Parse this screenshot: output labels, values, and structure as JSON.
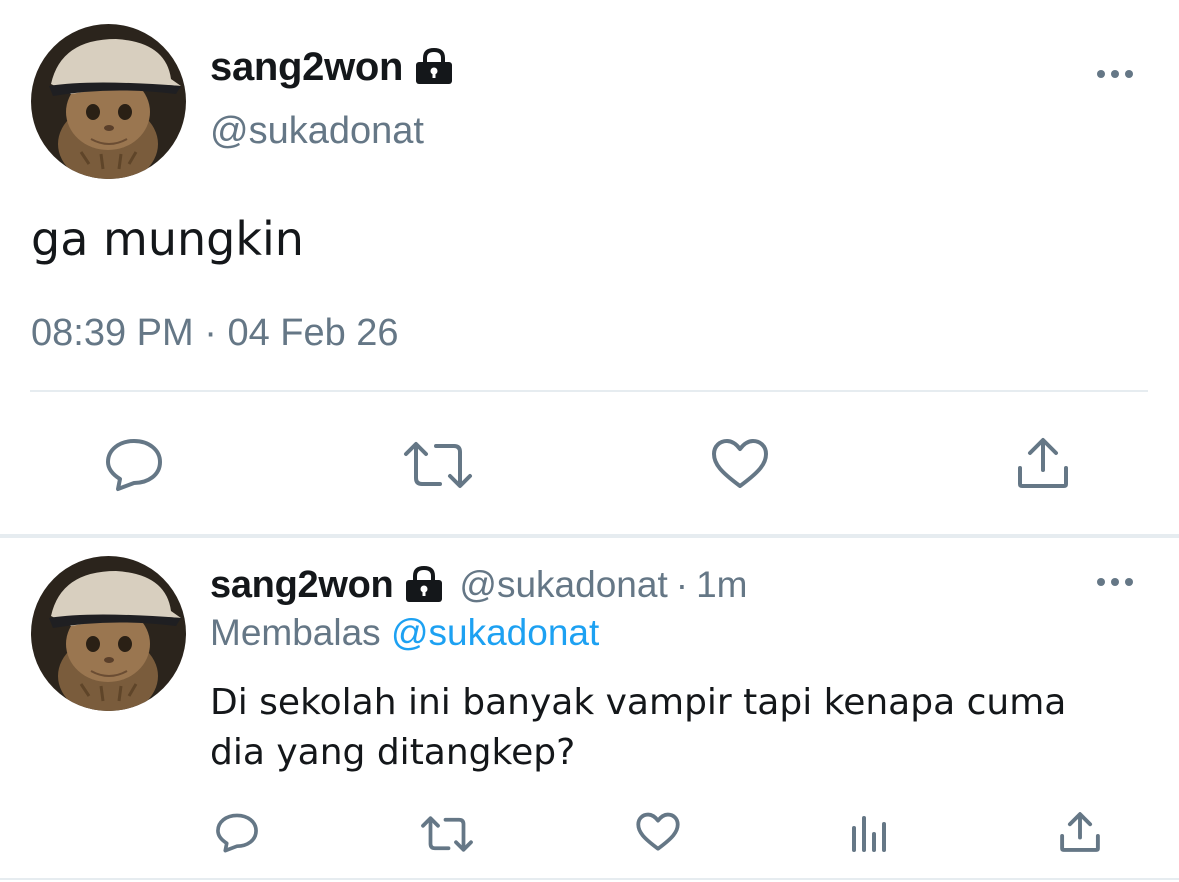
{
  "main_tweet": {
    "display_name": "sang2won",
    "handle": "@sukadonat",
    "text": "ga mungkin",
    "time": "08:39 PM",
    "separator": "·",
    "date": "04 Feb 26"
  },
  "reply_tweet": {
    "display_name": "sang2won",
    "handle": "@sukadonat",
    "separator": "·",
    "age": "1m",
    "replying_label": "Membalas",
    "replying_to": "@sukadonat",
    "text_line1": "Di sekolah ini banyak vampir tapi kenapa cuma",
    "text_line2": "dia yang ditangkep?"
  },
  "icons": {
    "lock": "lock-icon",
    "more": "more-icon",
    "reply": "reply-icon",
    "retweet": "retweet-icon",
    "like": "like-icon",
    "share": "share-icon",
    "analytics": "analytics-icon"
  },
  "colors": {
    "text": "#14171a",
    "secondary": "#657786",
    "link": "#1da1f2",
    "divider": "#e6ecf0"
  }
}
